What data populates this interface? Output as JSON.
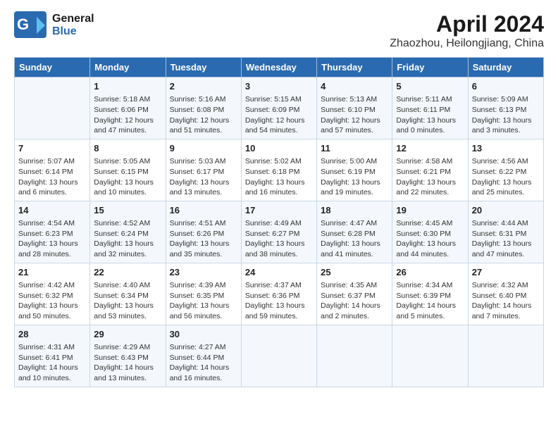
{
  "logo": {
    "line1": "General",
    "line2": "Blue"
  },
  "title": "April 2024",
  "subtitle": "Zhaozhou, Heilongjiang, China",
  "headers": [
    "Sunday",
    "Monday",
    "Tuesday",
    "Wednesday",
    "Thursday",
    "Friday",
    "Saturday"
  ],
  "weeks": [
    [
      {
        "day": "",
        "content": ""
      },
      {
        "day": "1",
        "content": "Sunrise: 5:18 AM\nSunset: 6:06 PM\nDaylight: 12 hours\nand 47 minutes."
      },
      {
        "day": "2",
        "content": "Sunrise: 5:16 AM\nSunset: 6:08 PM\nDaylight: 12 hours\nand 51 minutes."
      },
      {
        "day": "3",
        "content": "Sunrise: 5:15 AM\nSunset: 6:09 PM\nDaylight: 12 hours\nand 54 minutes."
      },
      {
        "day": "4",
        "content": "Sunrise: 5:13 AM\nSunset: 6:10 PM\nDaylight: 12 hours\nand 57 minutes."
      },
      {
        "day": "5",
        "content": "Sunrise: 5:11 AM\nSunset: 6:11 PM\nDaylight: 13 hours\nand 0 minutes."
      },
      {
        "day": "6",
        "content": "Sunrise: 5:09 AM\nSunset: 6:13 PM\nDaylight: 13 hours\nand 3 minutes."
      }
    ],
    [
      {
        "day": "7",
        "content": "Sunrise: 5:07 AM\nSunset: 6:14 PM\nDaylight: 13 hours\nand 6 minutes."
      },
      {
        "day": "8",
        "content": "Sunrise: 5:05 AM\nSunset: 6:15 PM\nDaylight: 13 hours\nand 10 minutes."
      },
      {
        "day": "9",
        "content": "Sunrise: 5:03 AM\nSunset: 6:17 PM\nDaylight: 13 hours\nand 13 minutes."
      },
      {
        "day": "10",
        "content": "Sunrise: 5:02 AM\nSunset: 6:18 PM\nDaylight: 13 hours\nand 16 minutes."
      },
      {
        "day": "11",
        "content": "Sunrise: 5:00 AM\nSunset: 6:19 PM\nDaylight: 13 hours\nand 19 minutes."
      },
      {
        "day": "12",
        "content": "Sunrise: 4:58 AM\nSunset: 6:21 PM\nDaylight: 13 hours\nand 22 minutes."
      },
      {
        "day": "13",
        "content": "Sunrise: 4:56 AM\nSunset: 6:22 PM\nDaylight: 13 hours\nand 25 minutes."
      }
    ],
    [
      {
        "day": "14",
        "content": "Sunrise: 4:54 AM\nSunset: 6:23 PM\nDaylight: 13 hours\nand 28 minutes."
      },
      {
        "day": "15",
        "content": "Sunrise: 4:52 AM\nSunset: 6:24 PM\nDaylight: 13 hours\nand 32 minutes."
      },
      {
        "day": "16",
        "content": "Sunrise: 4:51 AM\nSunset: 6:26 PM\nDaylight: 13 hours\nand 35 minutes."
      },
      {
        "day": "17",
        "content": "Sunrise: 4:49 AM\nSunset: 6:27 PM\nDaylight: 13 hours\nand 38 minutes."
      },
      {
        "day": "18",
        "content": "Sunrise: 4:47 AM\nSunset: 6:28 PM\nDaylight: 13 hours\nand 41 minutes."
      },
      {
        "day": "19",
        "content": "Sunrise: 4:45 AM\nSunset: 6:30 PM\nDaylight: 13 hours\nand 44 minutes."
      },
      {
        "day": "20",
        "content": "Sunrise: 4:44 AM\nSunset: 6:31 PM\nDaylight: 13 hours\nand 47 minutes."
      }
    ],
    [
      {
        "day": "21",
        "content": "Sunrise: 4:42 AM\nSunset: 6:32 PM\nDaylight: 13 hours\nand 50 minutes."
      },
      {
        "day": "22",
        "content": "Sunrise: 4:40 AM\nSunset: 6:34 PM\nDaylight: 13 hours\nand 53 minutes."
      },
      {
        "day": "23",
        "content": "Sunrise: 4:39 AM\nSunset: 6:35 PM\nDaylight: 13 hours\nand 56 minutes."
      },
      {
        "day": "24",
        "content": "Sunrise: 4:37 AM\nSunset: 6:36 PM\nDaylight: 13 hours\nand 59 minutes."
      },
      {
        "day": "25",
        "content": "Sunrise: 4:35 AM\nSunset: 6:37 PM\nDaylight: 14 hours\nand 2 minutes."
      },
      {
        "day": "26",
        "content": "Sunrise: 4:34 AM\nSunset: 6:39 PM\nDaylight: 14 hours\nand 5 minutes."
      },
      {
        "day": "27",
        "content": "Sunrise: 4:32 AM\nSunset: 6:40 PM\nDaylight: 14 hours\nand 7 minutes."
      }
    ],
    [
      {
        "day": "28",
        "content": "Sunrise: 4:31 AM\nSunset: 6:41 PM\nDaylight: 14 hours\nand 10 minutes."
      },
      {
        "day": "29",
        "content": "Sunrise: 4:29 AM\nSunset: 6:43 PM\nDaylight: 14 hours\nand 13 minutes."
      },
      {
        "day": "30",
        "content": "Sunrise: 4:27 AM\nSunset: 6:44 PM\nDaylight: 14 hours\nand 16 minutes."
      },
      {
        "day": "",
        "content": ""
      },
      {
        "day": "",
        "content": ""
      },
      {
        "day": "",
        "content": ""
      },
      {
        "day": "",
        "content": ""
      }
    ]
  ]
}
